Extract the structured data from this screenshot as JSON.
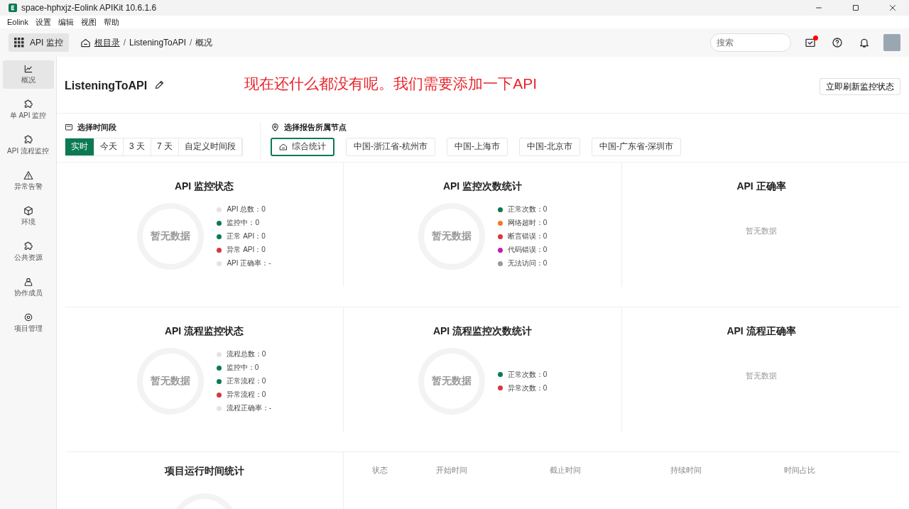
{
  "window": {
    "title": "space-hphxjz-Eolink APIKit 10.6.1.6"
  },
  "menu": [
    "Eolink",
    "设置",
    "编辑",
    "视图",
    "帮助"
  ],
  "toolbar": {
    "app_button": "API 监控",
    "breadcrumb": [
      {
        "label": "根目录",
        "link": true
      },
      {
        "label": "ListeningToAPI",
        "link": false
      },
      {
        "label": "概况",
        "link": false
      }
    ],
    "separator": "/",
    "search": {
      "placeholder": "搜索"
    },
    "notification_dot": true
  },
  "sidebar": {
    "items": [
      {
        "label": "概况",
        "kind": "chart",
        "selected": true
      },
      {
        "label": "单 API 监控",
        "kind": "puzzle",
        "selected": false
      },
      {
        "label": "API 流程监控",
        "kind": "puzzle",
        "selected": false
      },
      {
        "label": "异常告警",
        "kind": "warning",
        "selected": false
      },
      {
        "label": "环境",
        "kind": "cube",
        "selected": false
      },
      {
        "label": "公共资源",
        "kind": "puzzle",
        "selected": false
      },
      {
        "label": "协作成员",
        "kind": "person",
        "selected": false
      },
      {
        "label": "项目管理",
        "kind": "gear",
        "selected": false
      }
    ]
  },
  "project": {
    "name": "ListeningToAPI",
    "annotation": "现在还什么都没有呢。我们需要添加一下API",
    "refresh_button": "立即刷新监控状态"
  },
  "time_range": {
    "label": "选择时间段",
    "options": [
      {
        "label": "实时",
        "selected": true
      },
      {
        "label": "今天",
        "selected": false
      },
      {
        "label": "3 天",
        "selected": false
      },
      {
        "label": "7 天",
        "selected": false
      },
      {
        "label": "自定义时间段",
        "selected": false
      }
    ]
  },
  "nodes": {
    "label": "选择报告所属节点",
    "options": [
      {
        "label": "综合统计",
        "selected": true
      },
      {
        "label": "中国-浙江省-杭州市",
        "selected": false
      },
      {
        "label": "中国-上海市",
        "selected": false
      },
      {
        "label": "中国-北京市",
        "selected": false
      },
      {
        "label": "中国-广东省-深圳市",
        "selected": false
      }
    ]
  },
  "panel_rows": [
    [
      {
        "kind": "donut",
        "title": "API 监控状态",
        "empty_text": "暂无数据",
        "legend": [
          {
            "label": "API 总数：0",
            "color": "#e3e3e3"
          },
          {
            "label": "监控中：0",
            "color": "#0b7a52"
          },
          {
            "label": "正常 API：0",
            "color": "#0b7a52"
          },
          {
            "label": "异常 API：0",
            "color": "#d9363e"
          },
          {
            "label": "API 正确率：-",
            "color": "#e3e3e3"
          }
        ]
      },
      {
        "kind": "donut",
        "title": "API 监控次数统计",
        "empty_text": "暂无数据",
        "legend": [
          {
            "label": "正常次数：0",
            "color": "#0b7a52"
          },
          {
            "label": "网络超时：0",
            "color": "#f07a2a"
          },
          {
            "label": "断言错误：0",
            "color": "#d9363e"
          },
          {
            "label": "代码错误：0",
            "color": "#c21bb5"
          },
          {
            "label": "无法访问：0",
            "color": "#999999"
          }
        ]
      },
      {
        "kind": "empty",
        "title": "API 正确率",
        "empty_text": "暂无数据"
      }
    ],
    [
      {
        "kind": "donut",
        "title": "API 流程监控状态",
        "empty_text": "暂无数据",
        "legend": [
          {
            "label": "流程总数：0",
            "color": "#e3e3e3"
          },
          {
            "label": "监控中：0",
            "color": "#0b7a52"
          },
          {
            "label": "正常流程：0",
            "color": "#0b7a52"
          },
          {
            "label": "异常流程：0",
            "color": "#d9363e"
          },
          {
            "label": "流程正确率：-",
            "color": "#e3e3e3"
          }
        ]
      },
      {
        "kind": "donut",
        "title": "API 流程监控次数统计",
        "empty_text": "暂无数据",
        "legend": [
          {
            "label": "正常次数：0",
            "color": "#0b7a52"
          },
          {
            "label": "异常次数：0",
            "color": "#d9363e"
          }
        ]
      },
      {
        "kind": "empty",
        "title": "API 流程正确率",
        "empty_text": "暂无数据"
      }
    ]
  ],
  "runtime": {
    "title": "项目运行时间统计",
    "columns": [
      "状态",
      "开始时间",
      "截止时间",
      "持续时间",
      "时间占比"
    ]
  }
}
